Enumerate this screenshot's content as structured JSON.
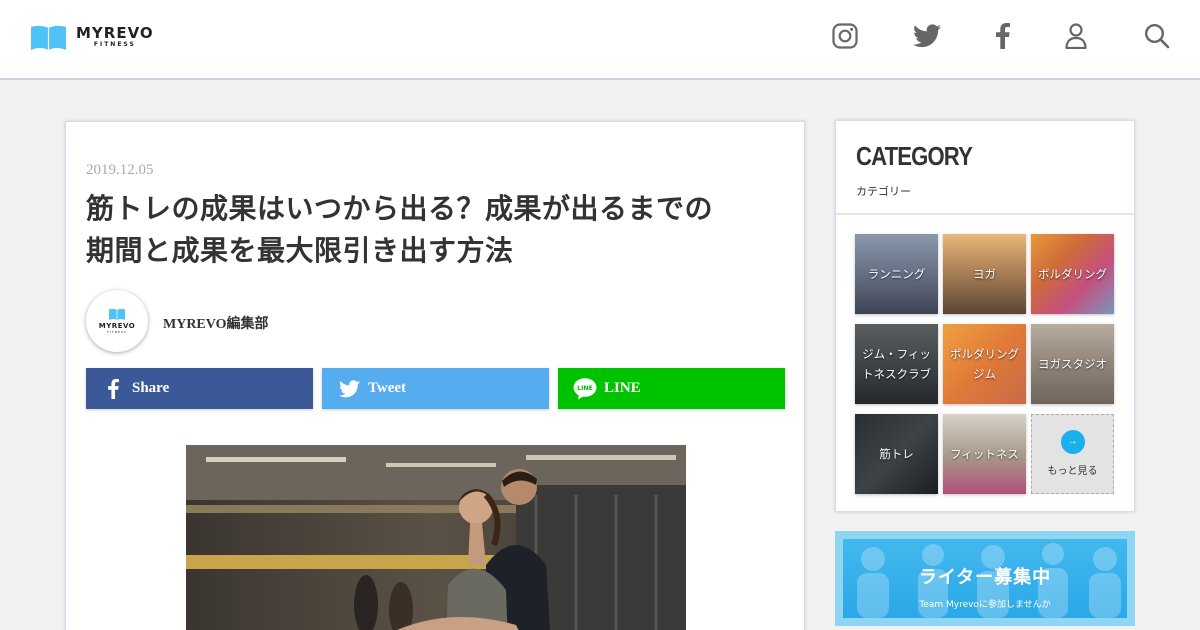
{
  "header": {
    "logo_main": "MYREVO",
    "logo_sub": "FITNESS",
    "brand_color": "#4fc3f7",
    "icons": [
      "instagram-icon",
      "twitter-icon",
      "facebook-icon",
      "user-icon",
      "search-icon"
    ]
  },
  "article": {
    "date": "2019.12.05",
    "title_line1": "筋トレの成果はいつから出る？成果が出るまでの",
    "title_line2": "期間と成果を最大限引き出す方法",
    "author": {
      "avatar_main": "MYREVO",
      "avatar_sub": "FITNESS",
      "name": "MYREVO編集部"
    },
    "share": {
      "facebook": {
        "label": "Share",
        "color": "#3b5998"
      },
      "twitter": {
        "label": "Tweet",
        "color": "#55acee"
      },
      "line": {
        "label": "LINE",
        "icon_text": "LINE",
        "color": "#00c300"
      }
    }
  },
  "sidebar": {
    "category": {
      "heading": "CATEGORY",
      "subheading": "カテゴリー",
      "items": [
        {
          "label": "ランニング"
        },
        {
          "label": "ヨガ"
        },
        {
          "label": "ボルダリング"
        },
        {
          "label_line1": "ジム・フィッ",
          "label_line2": "トネスクラブ"
        },
        {
          "label_line1": "ボルダリング",
          "label_line2": "ジム"
        },
        {
          "label": "ヨガスタジオ"
        },
        {
          "label": "筋トレ"
        },
        {
          "label": "フィットネス"
        }
      ],
      "more": {
        "arrow": "→",
        "label": "もっと見る"
      }
    },
    "banner": {
      "title": "ライター募集中",
      "subtitle": "Team Myrevoに参加しませんか"
    }
  }
}
